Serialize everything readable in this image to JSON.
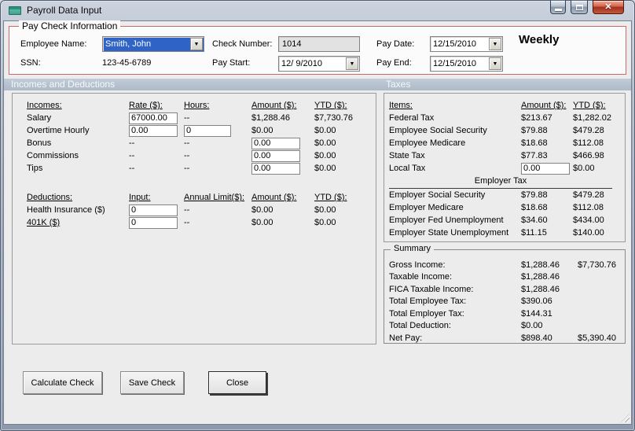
{
  "window": {
    "title": "Payroll Data Input"
  },
  "paycheck": {
    "legend": "Pay Check Information",
    "fields": {
      "employee_name": {
        "label": "Employee Name:",
        "value": "Smith, John"
      },
      "ssn": {
        "label": "SSN:",
        "value": "123-45-6789"
      },
      "check_number": {
        "label": "Check Number:",
        "value": "1014"
      },
      "pay_start": {
        "label": "Pay Start:",
        "value": "12/ 9/2010"
      },
      "pay_date": {
        "label": "Pay Date:",
        "value": "12/15/2010"
      },
      "pay_end": {
        "label": "Pay End:",
        "value": "12/15/2010"
      }
    },
    "frequency": "Weekly"
  },
  "sections": {
    "incomes_header": "Incomes and Deductions",
    "taxes_header": "Taxes"
  },
  "incomes": {
    "headers": {
      "item": "Incomes:",
      "rate": "Rate ($):",
      "hours": "Hours:",
      "amount": "Amount ($):",
      "ytd": "YTD ($):"
    },
    "rows": [
      {
        "label": "Salary",
        "rate": "67000.00",
        "hours": "--",
        "amount": "$1,288.46",
        "ytd": "$7,730.76"
      },
      {
        "label": "Overtime Hourly",
        "rate": "0.00",
        "hours": "0",
        "amount": "$0.00",
        "ytd": "$0.00"
      },
      {
        "label": "Bonus",
        "rate": "--",
        "hours": "--",
        "amount": "0.00",
        "ytd": "$0.00"
      },
      {
        "label": "Commissions",
        "rate": "--",
        "hours": "--",
        "amount": "0.00",
        "ytd": "$0.00"
      },
      {
        "label": "Tips",
        "rate": "--",
        "hours": "--",
        "amount": "0.00",
        "ytd": "$0.00"
      }
    ]
  },
  "deductions": {
    "headers": {
      "item": "Deductions:",
      "input": "Input:",
      "limit": "Annual Limit($):",
      "amount": "Amount ($):",
      "ytd": "YTD ($):"
    },
    "rows": [
      {
        "label": "Health Insurance ($)",
        "input": "0",
        "limit": "--",
        "amount": "$0.00",
        "ytd": "$0.00"
      },
      {
        "label": "401K ($)",
        "input": "0",
        "limit": "--",
        "amount": "$0.00",
        "ytd": "$0.00"
      }
    ]
  },
  "taxes": {
    "headers": {
      "item": "Items:",
      "amount": "Amount ($):",
      "ytd": "YTD ($):"
    },
    "employee_rows": [
      {
        "label": "Federal Tax",
        "amount": "$213.67",
        "ytd": "$1,282.02"
      },
      {
        "label": "Employee Social Security",
        "amount": "$79.88",
        "ytd": "$479.28"
      },
      {
        "label": "Employee Medicare",
        "amount": "$18.68",
        "ytd": "$112.08"
      },
      {
        "label": "State Tax",
        "amount": "$77.83",
        "ytd": "$466.98"
      },
      {
        "label": "Local Tax",
        "amount": "0.00",
        "ytd": "$0.00"
      }
    ],
    "employer_divider": "Employer Tax",
    "employer_rows": [
      {
        "label": "Employer Social Security",
        "amount": "$79.88",
        "ytd": "$479.28"
      },
      {
        "label": "Employer Medicare",
        "amount": "$18.68",
        "ytd": "$112.08"
      },
      {
        "label": "Employer Fed Unemployment",
        "amount": "$34.60",
        "ytd": "$434.00"
      },
      {
        "label": "Employer State Unemployment",
        "amount": "$11.15",
        "ytd": "$140.00"
      }
    ]
  },
  "summary": {
    "legend": "Summary",
    "rows": [
      {
        "label": "Gross Income:",
        "value": "$1,288.46",
        "ytd": "$7,730.76"
      },
      {
        "label": "Taxable Income:",
        "value": "$1,288.46",
        "ytd": ""
      },
      {
        "label": "FICA Taxable Income:",
        "value": "$1,288.46",
        "ytd": ""
      },
      {
        "label": "Total Employee Tax:",
        "value": "$390.06",
        "ytd": ""
      },
      {
        "label": "Total Employer Tax:",
        "value": "$144.31",
        "ytd": ""
      },
      {
        "label": "Total Deduction:",
        "value": "$0.00",
        "ytd": ""
      },
      {
        "label": "Net Pay:",
        "value": "$898.40",
        "ytd": "$5,390.40"
      }
    ]
  },
  "buttons": {
    "calculate": "Calculate Check",
    "save": "Save Check",
    "close": "Close"
  },
  "colors": {
    "section_band": "#b4c0ce",
    "paycheck_border": "#c96a6a",
    "combobox_selection": "#2f63c6",
    "close_button_red": "#a23120",
    "panel_background": "#ececec"
  }
}
